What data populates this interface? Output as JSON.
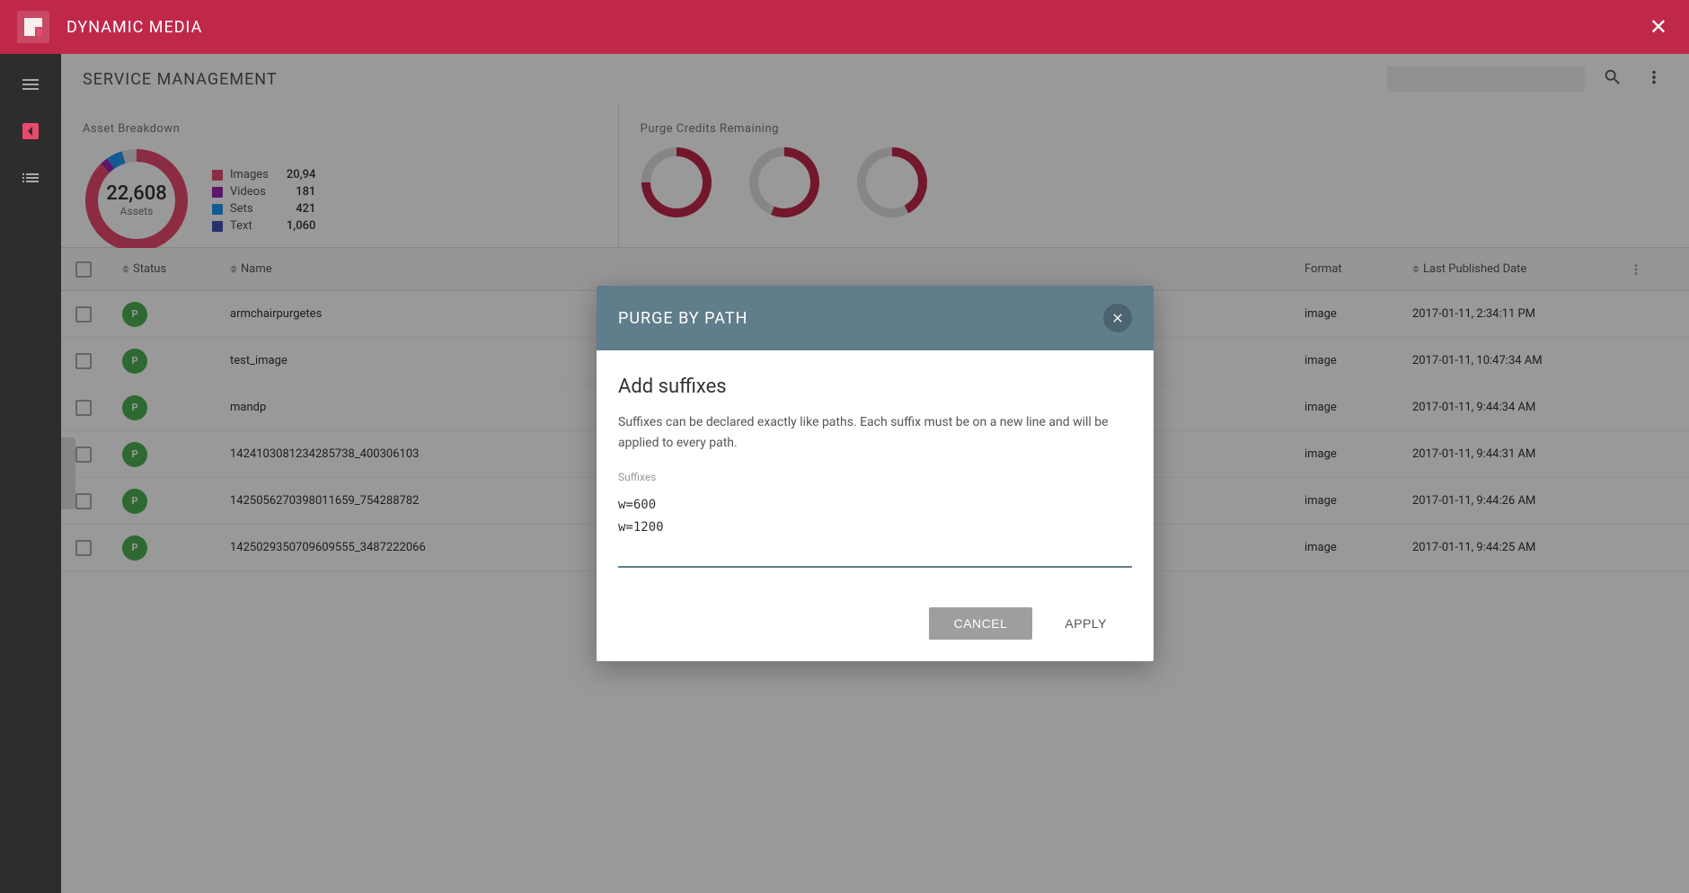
{
  "app": {
    "title": "DYNAMIC MEDIA",
    "close_label": "✕"
  },
  "header": {
    "title": "SERVICE MANAGEMENT",
    "search_placeholder": ""
  },
  "sidebar": {
    "items": [
      {
        "id": "menu",
        "icon": "menu"
      },
      {
        "id": "arrow",
        "icon": "arrow"
      },
      {
        "id": "list",
        "icon": "list"
      }
    ]
  },
  "stats": {
    "asset_breakdown": {
      "title": "Asset Breakdown",
      "total_number": "22,608",
      "total_label": "Assets",
      "legend": [
        {
          "label": "Images",
          "value": "20,94",
          "color": "#e84a6f"
        },
        {
          "label": "Videos",
          "value": "181",
          "color": "#9c27b0"
        },
        {
          "label": "Sets",
          "value": "421",
          "color": "#2196f3"
        },
        {
          "label": "Text",
          "value": "1,060",
          "color": "#3f51b5"
        }
      ]
    },
    "purge_credits": {
      "title": "Purge Credits Remaining"
    }
  },
  "table": {
    "columns": [
      {
        "id": "checkbox",
        "label": ""
      },
      {
        "id": "status",
        "label": "Status"
      },
      {
        "id": "name",
        "label": "Name"
      },
      {
        "id": "format",
        "label": "Format"
      },
      {
        "id": "date",
        "label": "Last Published Date"
      },
      {
        "id": "actions",
        "label": ""
      }
    ],
    "rows": [
      {
        "id": 1,
        "status": "P",
        "name": "armchairpurgetes",
        "format": "image",
        "date": "2017-01-11, 2:34:11 PM"
      },
      {
        "id": 2,
        "status": "P",
        "name": "test_image",
        "format": "image",
        "date": "2017-01-11, 10:47:34 AM"
      },
      {
        "id": 3,
        "status": "P",
        "name": "mandp",
        "format": "image",
        "date": "2017-01-11, 9:44:34 AM"
      },
      {
        "id": 4,
        "status": "P",
        "name": "1424103081234285738_400306103",
        "format": "image",
        "date": "2017-01-11, 9:44:31 AM"
      },
      {
        "id": 5,
        "status": "P",
        "name": "1425056270398011659_754288782",
        "format": "image",
        "date": "2017-01-11, 9:44:26 AM"
      },
      {
        "id": 6,
        "status": "P",
        "name": "1425029350709609555_3487222066",
        "format": "image",
        "date": "2017-01-11, 9:44:25 AM"
      }
    ]
  },
  "dialog": {
    "title": "PURGE BY PATH",
    "section_title": "Add suffixes",
    "description": "Suffixes can be declared exactly like paths. Each suffix must be on a new line and will be applied to every path.",
    "input_label": "Suffixes",
    "suffixes_value": "w=600\nw=1200",
    "cancel_label": "CANCEL",
    "apply_label": "APPLY"
  }
}
